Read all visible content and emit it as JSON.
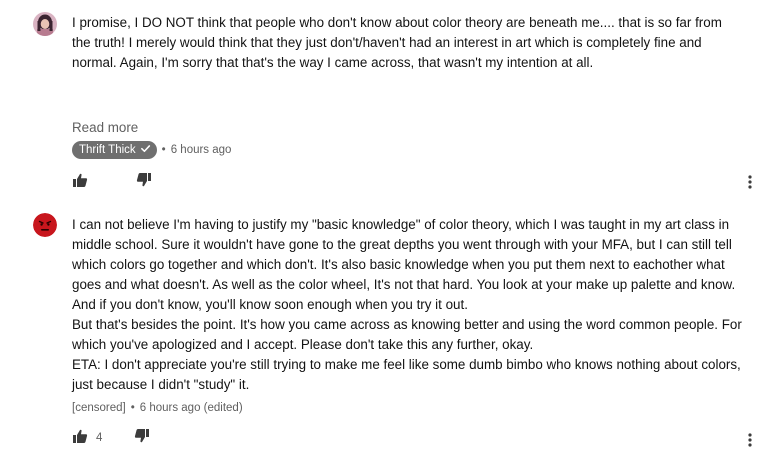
{
  "comments": [
    {
      "text": "I promise, I DO NOT think that people who don't know about color theory are beneath me.... that is so far from the truth! I merely would think that they just don't/haven't had an interest in art which is completely fine and normal. Again, I'm sorry that that's the way I came across, that wasn't my intention at all.",
      "read_more": "Read more",
      "author": "Thrift Thick",
      "time": "6 hours ago",
      "likes": ""
    },
    {
      "text": "I can not believe I'm having to justify my \"basic knowledge\" of color theory, which I was taught in my art class in middle school. Sure it wouldn't have gone to the great depths you went through with your MFA, but I can still tell which colors go together and which don't. It's also basic knowledge when you put them next to eachother what goes and what doesn't. As well as the color wheel, It's not that hard. You look at your make up palette and know. And if you don't know, you'll know soon enough when you try it out.\nBut that's besides the point. It's how you came across as knowing better and using the word common people. For which you've apologized and I accept. Please don't take this any further, okay.\nETA: I don't appreciate you're still trying to make me feel like some dumb bimbo who knows nothing about colors, just because I didn't \"study\" it.",
      "author": "[censored]",
      "time": "6 hours ago (edited)",
      "likes": "4"
    }
  ],
  "separator": "•",
  "icons": {
    "like": "thumbs-up-icon",
    "dislike": "thumbs-down-icon",
    "more": "more-vert-icon",
    "verified": "checkmark-icon"
  },
  "colors": {
    "badge_bg": "#6f6f6f",
    "secondary_text": "#606060",
    "avatar2": "#c8161d"
  }
}
